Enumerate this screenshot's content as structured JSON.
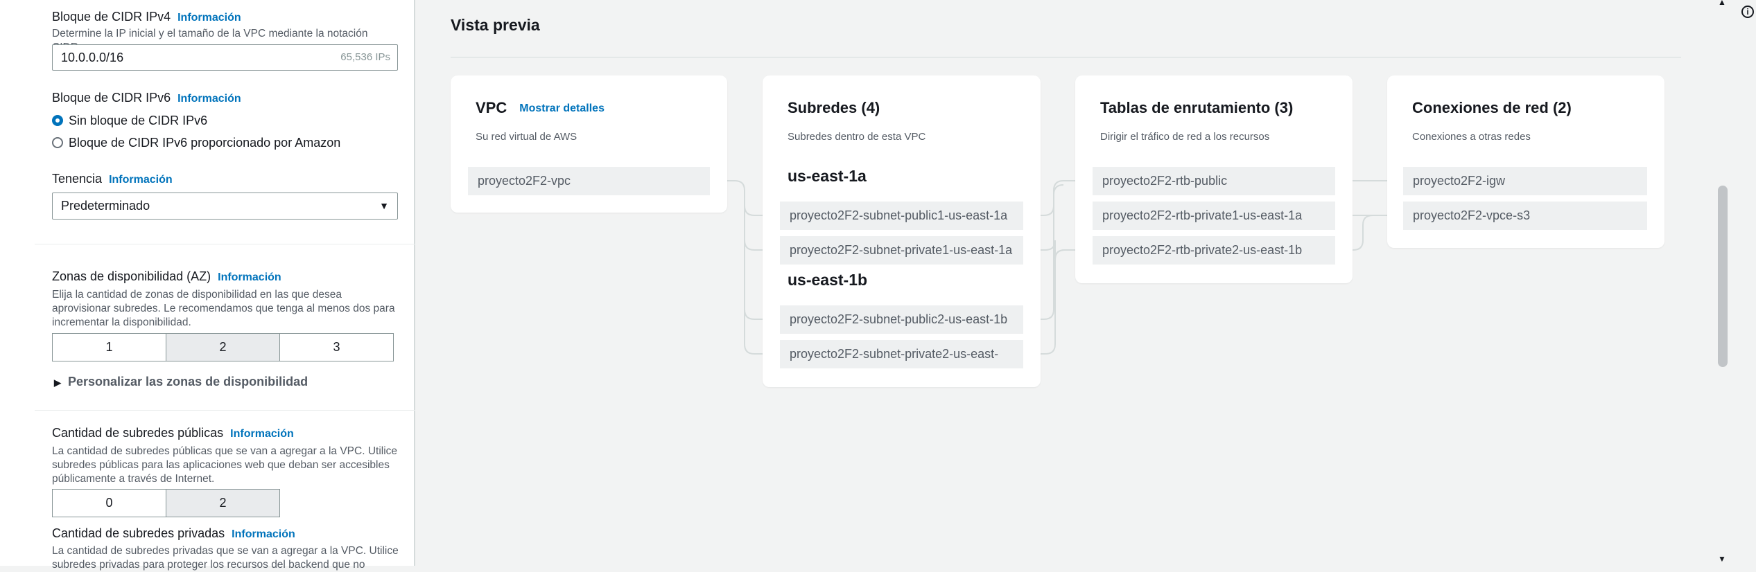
{
  "form": {
    "ipv4": {
      "label": "Bloque de CIDR IPv4",
      "info": "Información",
      "description": "Determine la IP inicial y el tamaño de la VPC mediante la notación CIDR.",
      "value": "10.0.0.0/16",
      "suffix": "65,536 IPs"
    },
    "ipv6": {
      "label": "Bloque de CIDR IPv6",
      "info": "Información",
      "options": [
        "Sin bloque de CIDR IPv6",
        "Bloque de CIDR IPv6 proporcionado por Amazon"
      ],
      "selected_index": 0
    },
    "tenancy": {
      "label": "Tenencia",
      "info": "Información",
      "value": "Predeterminado"
    },
    "az": {
      "label": "Zonas de disponibilidad (AZ)",
      "info": "Información",
      "description": "Elija la cantidad de zonas de disponibilidad en las que desea aprovisionar subredes. Le recomendamos que tenga al menos dos para incrementar la disponibilidad.",
      "options": [
        "1",
        "2",
        "3"
      ],
      "selected": "2",
      "customize": "Personalizar las zonas de disponibilidad"
    },
    "public_subnets": {
      "label": "Cantidad de subredes públicas",
      "info": "Información",
      "description": "La cantidad de subredes públicas que se van a agregar a la VPC. Utilice subredes públicas para las aplicaciones web que deban ser accesibles públicamente a través de Internet.",
      "options": [
        "0",
        "2"
      ],
      "selected": "2"
    },
    "private_subnets": {
      "label": "Cantidad de subredes privadas",
      "info": "Información",
      "description": "La cantidad de subredes privadas que se van a agregar a la VPC. Utilice subredes privadas para proteger los recursos del backend que no"
    }
  },
  "preview": {
    "title": "Vista previa",
    "vpc": {
      "title": "VPC",
      "link": "Mostrar detalles",
      "subtitle": "Su red virtual de AWS",
      "items": [
        "proyecto2F2-vpc"
      ]
    },
    "subnets": {
      "title": "Subredes (4)",
      "subtitle": "Subredes dentro de esta VPC",
      "zones": [
        {
          "name": "us-east-1a",
          "items": [
            "proyecto2F2-subnet-public1-us-east-1a",
            "proyecto2F2-subnet-private1-us-east-1a"
          ]
        },
        {
          "name": "us-east-1b",
          "items": [
            "proyecto2F2-subnet-public2-us-east-1b",
            "proyecto2F2-subnet-private2-us-east-"
          ]
        }
      ]
    },
    "route_tables": {
      "title": "Tablas de enrutamiento (3)",
      "subtitle": "Dirigir el tráfico de red a los recursos",
      "items": [
        "proyecto2F2-rtb-public",
        "proyecto2F2-rtb-private1-us-east-1a",
        "proyecto2F2-rtb-private2-us-east-1b"
      ]
    },
    "connections": {
      "title": "Conexiones de red (2)",
      "subtitle": "Conexiones a otras redes",
      "items": [
        "proyecto2F2-igw",
        "proyecto2F2-vpce-s3"
      ]
    }
  },
  "colors": {
    "link": "#0073bb",
    "connector": "#d5dbdb",
    "chip": "#eef0f1"
  }
}
